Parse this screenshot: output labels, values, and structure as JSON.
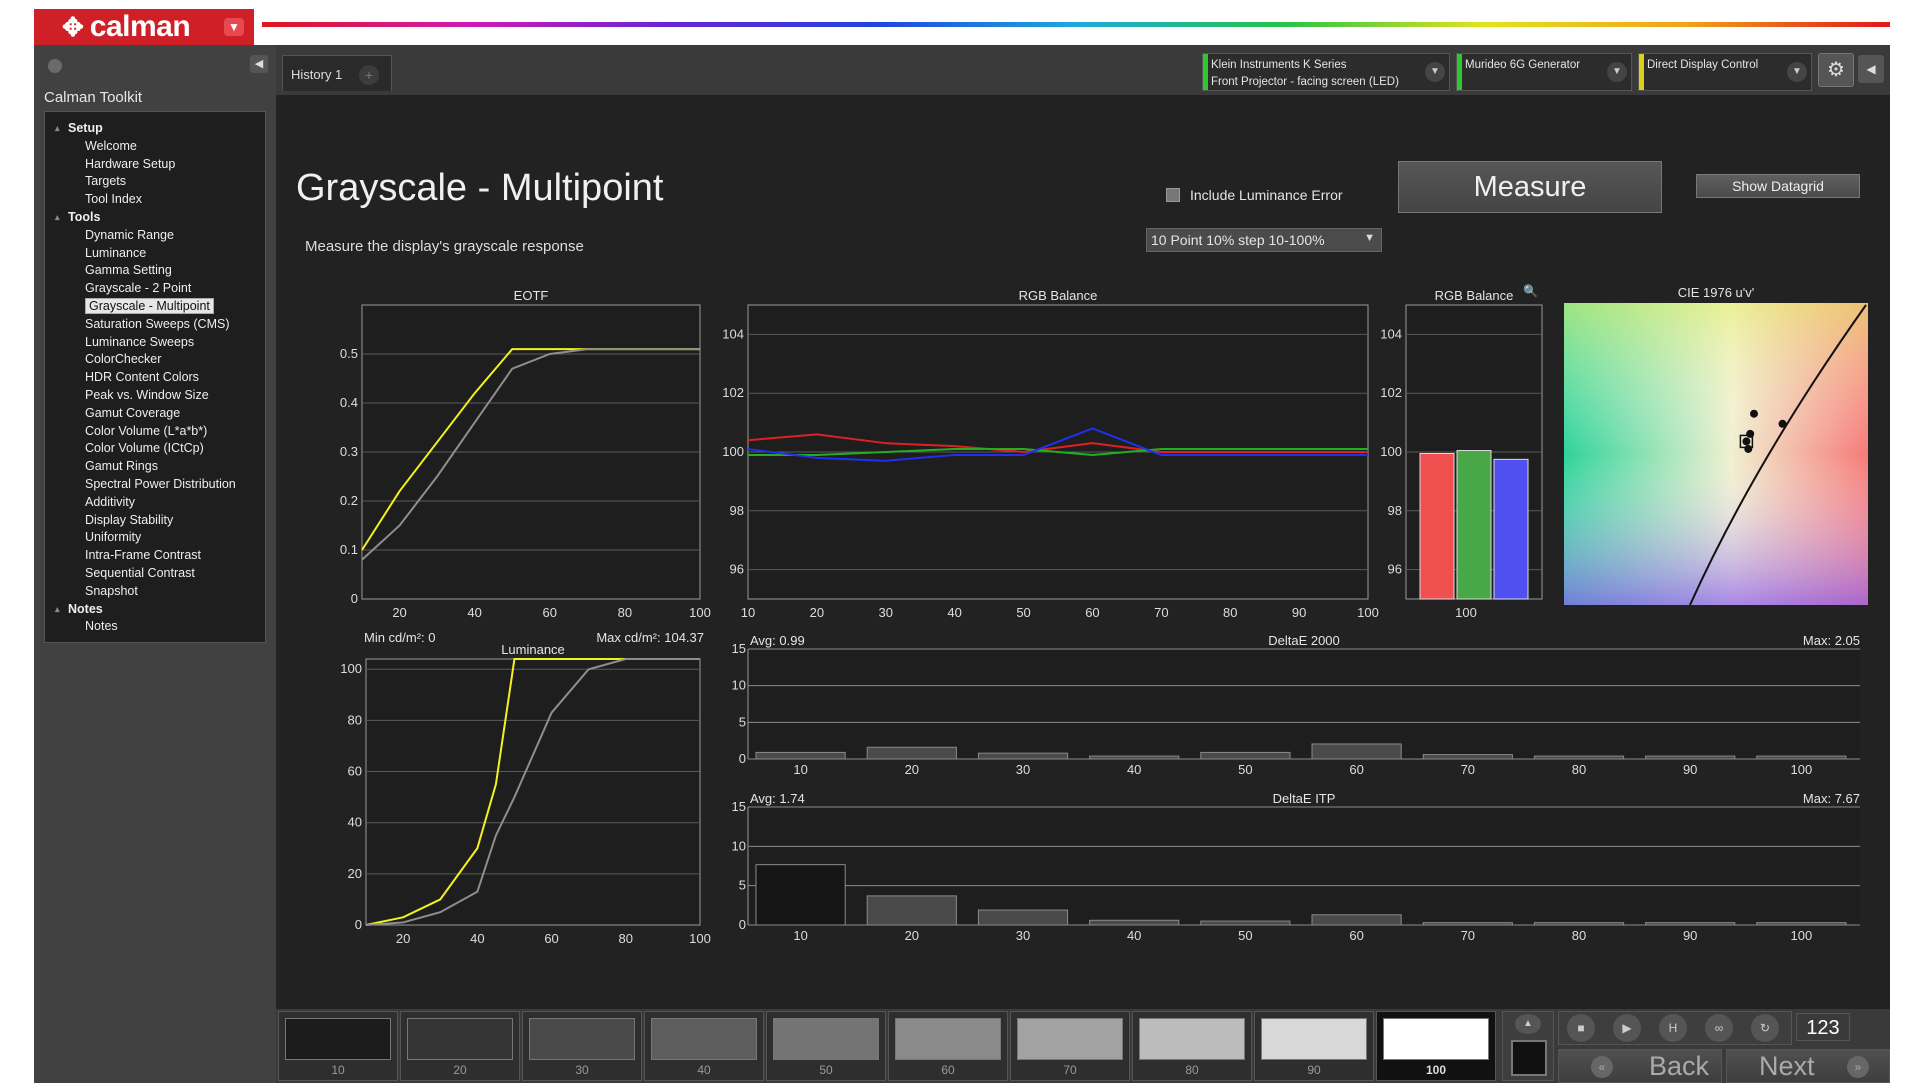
{
  "app": {
    "logo_text": "calman",
    "logo_mark": "✥"
  },
  "left_panel": {
    "title": "Calman Toolkit",
    "tree": [
      {
        "label": "Setup",
        "kind": "cat"
      },
      {
        "label": "Welcome",
        "kind": "item"
      },
      {
        "label": "Hardware Setup",
        "kind": "item"
      },
      {
        "label": "Targets",
        "kind": "item"
      },
      {
        "label": "Tool Index",
        "kind": "item"
      },
      {
        "label": "Tools",
        "kind": "cat"
      },
      {
        "label": "Dynamic Range",
        "kind": "item"
      },
      {
        "label": "Luminance",
        "kind": "item"
      },
      {
        "label": "Gamma Setting",
        "kind": "item"
      },
      {
        "label": "Grayscale - 2 Point",
        "kind": "item"
      },
      {
        "label": "Grayscale - Multipoint",
        "kind": "item",
        "selected": true
      },
      {
        "label": "Saturation Sweeps (CMS)",
        "kind": "item"
      },
      {
        "label": "Luminance Sweeps",
        "kind": "item"
      },
      {
        "label": "ColorChecker",
        "kind": "item"
      },
      {
        "label": "HDR Content Colors",
        "kind": "item"
      },
      {
        "label": "Peak vs. Window Size",
        "kind": "item"
      },
      {
        "label": "Gamut Coverage",
        "kind": "item"
      },
      {
        "label": "Color Volume (L*a*b*)",
        "kind": "item"
      },
      {
        "label": "Color Volume (ICtCp)",
        "kind": "item"
      },
      {
        "label": "Gamut Rings",
        "kind": "item"
      },
      {
        "label": "Spectral Power Distribution",
        "kind": "item"
      },
      {
        "label": "Additivity",
        "kind": "item"
      },
      {
        "label": "Display Stability",
        "kind": "item"
      },
      {
        "label": "Uniformity",
        "kind": "item"
      },
      {
        "label": "Intra-Frame Contrast",
        "kind": "item"
      },
      {
        "label": "Sequential Contrast",
        "kind": "item"
      },
      {
        "label": "Snapshot",
        "kind": "item"
      },
      {
        "label": "Notes",
        "kind": "cat"
      },
      {
        "label": "Notes",
        "kind": "item"
      }
    ]
  },
  "tabs": {
    "history": "History 1",
    "add": "+"
  },
  "devices": [
    {
      "line1": "Klein Instruments K Series",
      "line2": "Front Projector - facing screen (LED)",
      "color": "#2ec82e"
    },
    {
      "line1": "Murideo 6G Generator",
      "line2": "",
      "color": "#2ec82e"
    },
    {
      "line1": "Direct Display Control",
      "line2": "",
      "color": "#d9d21c"
    }
  ],
  "page": {
    "title": "Grayscale - Multipoint",
    "subtitle": "Measure the display's grayscale response",
    "include_luminance_label": "Include Luminance Error",
    "measure_label": "Measure",
    "datagrid_label": "Show Datagrid",
    "step_option": "10 Point 10% step 10-100%"
  },
  "chart_data": [
    {
      "id": "eotf",
      "type": "line",
      "title": "EOTF",
      "x": [
        10,
        20,
        30,
        40,
        50,
        60,
        70,
        80,
        90,
        100
      ],
      "xticks": [
        "20",
        "40",
        "60",
        "80",
        "100"
      ],
      "yticks": [
        "0",
        "0.1",
        "0.2",
        "0.3",
        "0.4",
        "0.5"
      ],
      "xlim": [
        10,
        100
      ],
      "ylim": [
        0,
        0.6
      ],
      "series": [
        {
          "color": "#f2f21e",
          "values": [
            0.1,
            0.22,
            0.32,
            0.42,
            0.51,
            0.51,
            0.51,
            0.51,
            0.51,
            0.51
          ]
        },
        {
          "color": "#8e8e8e",
          "values": [
            0.08,
            0.15,
            0.25,
            0.36,
            0.47,
            0.5,
            0.51,
            0.51,
            0.51,
            0.51
          ]
        }
      ]
    },
    {
      "id": "rgb_balance",
      "type": "line",
      "title": "RGB Balance",
      "x": [
        10,
        20,
        30,
        40,
        50,
        60,
        70,
        80,
        90,
        100
      ],
      "xticks": [
        "10",
        "20",
        "30",
        "40",
        "50",
        "60",
        "70",
        "80",
        "90",
        "100"
      ],
      "yticks": [
        "96",
        "98",
        "100",
        "102",
        "104"
      ],
      "xlim": [
        10,
        100
      ],
      "ylim": [
        95,
        105
      ],
      "series": [
        {
          "color": "#e02020",
          "values": [
            100.4,
            100.6,
            100.3,
            100.2,
            100.0,
            100.3,
            100.0,
            100.0,
            100.0,
            100.0
          ]
        },
        {
          "color": "#20b020",
          "values": [
            99.9,
            99.9,
            100.0,
            100.1,
            100.1,
            99.9,
            100.1,
            100.1,
            100.1,
            100.1
          ]
        },
        {
          "color": "#2030f0",
          "values": [
            100.1,
            99.8,
            99.7,
            99.9,
            99.9,
            100.8,
            99.9,
            99.9,
            99.9,
            99.9
          ]
        }
      ]
    },
    {
      "id": "rgb_bars",
      "type": "bar",
      "title": "RGB Balance",
      "categories": [
        "100"
      ],
      "yticks": [
        "96",
        "98",
        "100",
        "102",
        "104"
      ],
      "ylim": [
        95,
        105
      ],
      "series": [
        {
          "color": "#f05050",
          "values": [
            99.95
          ]
        },
        {
          "color": "#48a848",
          "values": [
            100.05
          ]
        },
        {
          "color": "#5050f0",
          "values": [
            99.75
          ]
        }
      ]
    },
    {
      "id": "cie",
      "type": "scatter",
      "title": "CIE 1976 u'v'",
      "points": [
        {
          "u": 0.196,
          "v": 0.465
        },
        {
          "u": 0.198,
          "v": 0.468
        },
        {
          "u": 0.2,
          "v": 0.476
        },
        {
          "u": 0.215,
          "v": 0.472
        },
        {
          "u": 0.197,
          "v": 0.462
        }
      ]
    },
    {
      "id": "luminance",
      "type": "line",
      "title": "Luminance",
      "min_label": "Min cd/m²: 0",
      "max_label": "Max cd/m²: 104.37",
      "x": [
        10,
        20,
        30,
        40,
        45,
        50,
        60,
        70,
        80,
        90,
        100
      ],
      "xticks": [
        "20",
        "40",
        "60",
        "80",
        "100"
      ],
      "yticks": [
        "0",
        "20",
        "40",
        "60",
        "80",
        "100"
      ],
      "xlim": [
        10,
        100
      ],
      "ylim": [
        0,
        104
      ],
      "series": [
        {
          "color": "#f2f21e",
          "values": [
            0,
            3,
            10,
            30,
            55,
            104,
            104,
            104,
            104,
            104,
            104
          ]
        },
        {
          "color": "#8e8e8e",
          "values": [
            0,
            1,
            5,
            13,
            35,
            50,
            83,
            100,
            104,
            104,
            104
          ]
        }
      ]
    },
    {
      "id": "deltae2000",
      "type": "bar",
      "title": "DeltaE 2000",
      "avg_label": "Avg: 0.99",
      "max_label": "Max: 2.05",
      "categories": [
        "10",
        "20",
        "30",
        "40",
        "50",
        "60",
        "70",
        "80",
        "90",
        "100"
      ],
      "values": [
        0.9,
        1.6,
        0.8,
        0.4,
        0.9,
        2.05,
        0.6,
        0.4,
        0.4,
        0.4
      ],
      "yticks": [
        "0",
        "5",
        "10",
        "15"
      ],
      "ylim": [
        0,
        15
      ]
    },
    {
      "id": "deltaitp",
      "type": "bar",
      "title": "DeltaE ITP",
      "avg_label": "Avg: 1.74",
      "max_label": "Max: 7.67",
      "categories": [
        "10",
        "20",
        "30",
        "40",
        "50",
        "60",
        "70",
        "80",
        "90",
        "100"
      ],
      "values": [
        7.67,
        3.7,
        1.9,
        0.6,
        0.5,
        1.3,
        0.3,
        0.3,
        0.3,
        0.3
      ],
      "yticks": [
        "0",
        "5",
        "10",
        "15"
      ],
      "ylim": [
        0,
        15
      ]
    }
  ],
  "footer": {
    "swatches": [
      {
        "label": "10",
        "color": "#1b1b1b"
      },
      {
        "label": "20",
        "color": "#353535"
      },
      {
        "label": "30",
        "color": "#4a4a4a"
      },
      {
        "label": "40",
        "color": "#5e5e5e"
      },
      {
        "label": "50",
        "color": "#747474"
      },
      {
        "label": "60",
        "color": "#8a8a8a"
      },
      {
        "label": "70",
        "color": "#a2a2a2"
      },
      {
        "label": "80",
        "color": "#bcbcbc"
      },
      {
        "label": "90",
        "color": "#d8d8d8"
      },
      {
        "label": "100",
        "color": "#ffffff",
        "active": true
      }
    ],
    "counter": "123",
    "back_label": "Back",
    "next_label": "Next",
    "controls": [
      "stop-icon",
      "play-icon",
      "save-icon",
      "loop-icon",
      "refresh-icon"
    ]
  },
  "icons": {
    "gear": "⚙",
    "collapse_left": "◀",
    "chevron": "▼",
    "zoom": "🔍"
  }
}
